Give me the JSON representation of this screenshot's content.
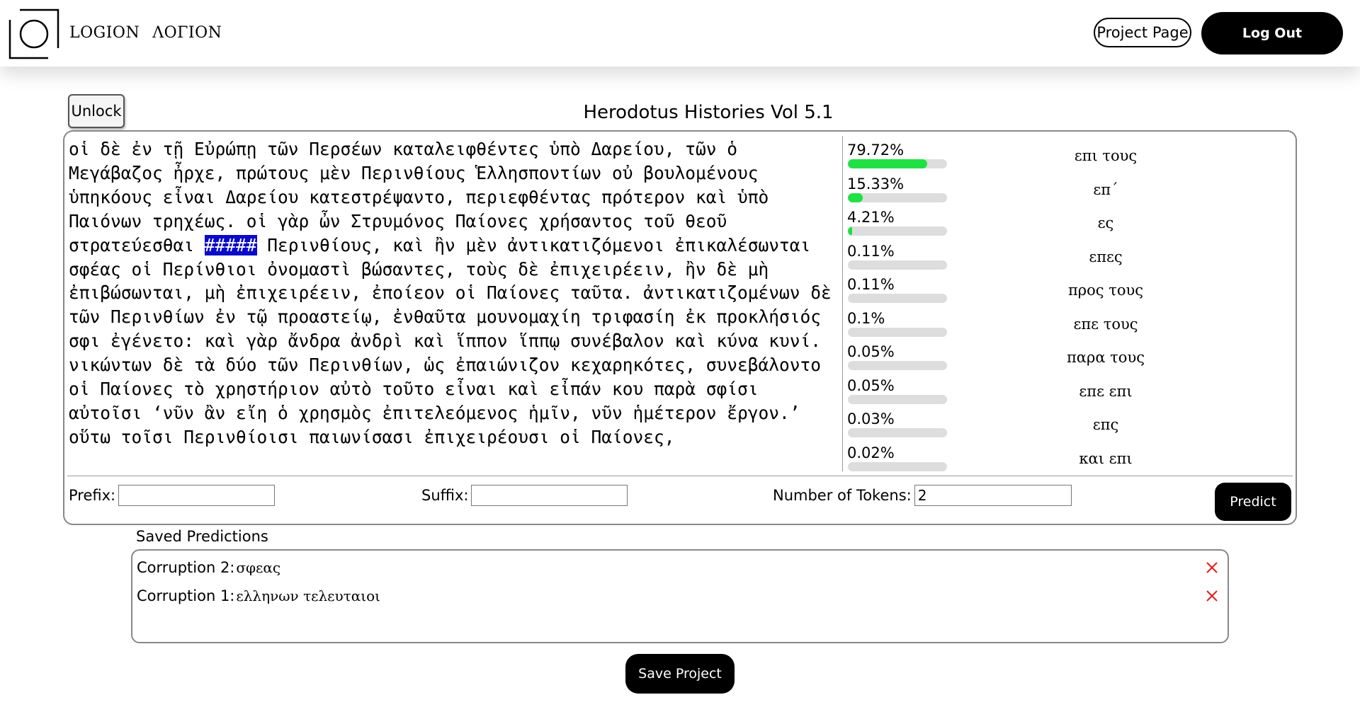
{
  "header": {
    "brand_latin": "LOGION",
    "brand_greek": "ΛΟΓΙΟΝ",
    "project_page_label": "Project Page",
    "logout_label": "Log Out"
  },
  "toolbar": {
    "unlock_label": "Unlock",
    "title": "Herodotus Histories Vol 5.1"
  },
  "editor": {
    "text_before": "οἱ δὲ ἐν τῇ Εὐρώπῃ τῶν Περσέων καταλειφθέντες ὑπὸ Δαρείου, τῶν ὁ Μεγάβαζος ἦρχε, πρώτους μὲν Περινθίους Ἑλλησποντίων οὐ βουλομένους ὑπηκόους εἶναι Δαρείου κατεστρέψαντο, περιεφθέντας πρότερον καὶ ὑπὸ Παιόνων τρηχέως. οἱ γὰρ ὦν Στρυμόνος Παίονες χρήσαντος τοῦ θεοῦ στρατεύεσθαι ",
    "mask": "#####",
    "text_after": " Περινθίους, καὶ ἢν μὲν ἀντικατιζόμενοι ἐπικαλέσωνται σφέας οἱ Περίνθιοι ὀνομαστὶ βώσαντες, τοὺς δὲ ἐπιχειρέειν, ἢν δὲ μὴ ἐπιβώσωνται, μὴ ἐπιχειρέειν, ἐποίεον οἱ Παίονες ταῦτα. ἀντικατιζομένων δὲ τῶν Περινθίων ἐν τῷ προαστείῳ, ἐνθαῦτα μουνομαχίη τριφασίη ἐκ προκλήσιός σφι ἐγένετο: καὶ γὰρ ἄνδρα ἀνδρὶ καὶ ἵππον ἵππῳ συνέβαλον καὶ κύνα κυνί. νικώντων δὲ τὰ δύο τῶν Περινθίων, ὡς ἐπαιώνιζον κεχαρηκότες, συνεβάλοντο οἱ Παίονες τὸ χρηστήριον αὐτὸ τοῦτο εἶναι καὶ εἶπάν κου παρὰ σφίσι αὐτοῖσι ‘νῦν ἂν εἴη ὁ χρησμὸς ἐπιτελεόμενος ἡμῖν, νῦν ἡμέτερον ἔργον.’ οὕτω τοῖσι Περινθίοισι παιωνίσασι ἐπιχειρέουσι οἱ Παίονες,"
  },
  "predictions": [
    {
      "percent": "79.72%",
      "value": 79.72,
      "text": "επι τους"
    },
    {
      "percent": "15.33%",
      "value": 15.33,
      "text": "επ΄"
    },
    {
      "percent": "4.21%",
      "value": 4.21,
      "text": "ες"
    },
    {
      "percent": "0.11%",
      "value": 0.11,
      "text": "επες"
    },
    {
      "percent": "0.11%",
      "value": 0.11,
      "text": "προς τους"
    },
    {
      "percent": "0.1%",
      "value": 0.1,
      "text": "επε τους"
    },
    {
      "percent": "0.05%",
      "value": 0.05,
      "text": "παρα τους"
    },
    {
      "percent": "0.05%",
      "value": 0.05,
      "text": "επε επι"
    },
    {
      "percent": "0.03%",
      "value": 0.03,
      "text": "επς"
    },
    {
      "percent": "0.02%",
      "value": 0.02,
      "text": "και επι"
    }
  ],
  "form": {
    "prefix_label": "Prefix:",
    "prefix_value": "",
    "suffix_label": "Suffix:",
    "suffix_value": "",
    "tokens_label": "Number of Tokens:",
    "tokens_value": "2",
    "predict_label": "Predict"
  },
  "saved": {
    "heading": "Saved Predictions",
    "items": [
      {
        "label": "Corruption 2:",
        "value": "σφεας"
      },
      {
        "label": "Corruption 1:",
        "value": "ελληνων τελευταιοι"
      }
    ]
  },
  "save_project_label": "Save Project",
  "colors": {
    "accent": "#000000",
    "mask_highlight": "#0a0ac8",
    "probability_bar": "#22e044",
    "delete": "#e02020"
  }
}
